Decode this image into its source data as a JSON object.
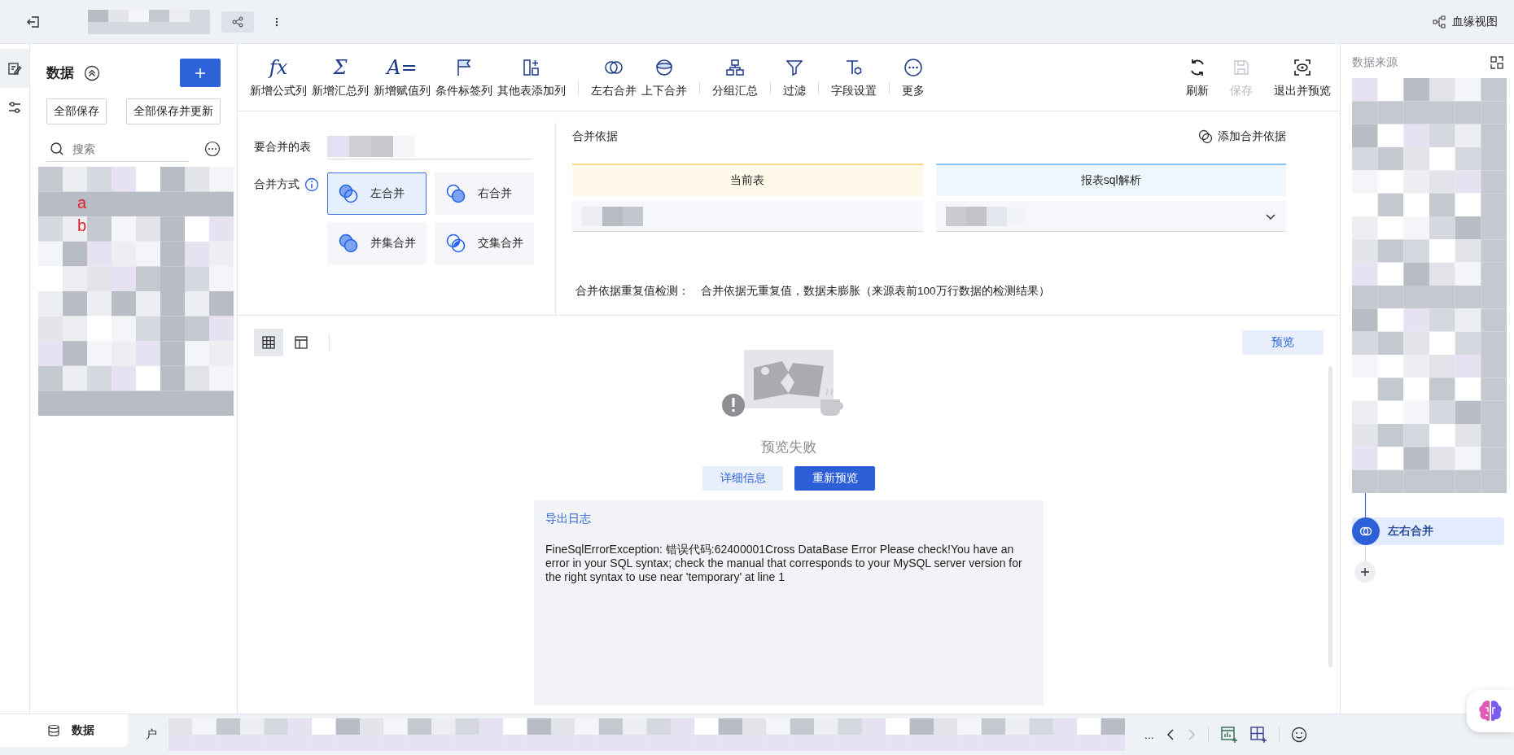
{
  "topbar": {
    "lineage_label": "血缘视图"
  },
  "sidebar": {
    "title": "数据",
    "buttons": [
      "全部保存",
      "全部保存并更新"
    ],
    "search": {
      "placeholder": "搜索"
    },
    "annotations": [
      "a",
      "b"
    ]
  },
  "toolbar": {
    "groups": [
      [
        {
          "label": "新增公式列",
          "kind": "glyph",
          "glyph": "fx"
        },
        {
          "label": "新增汇总列",
          "kind": "glyph",
          "glyph": "Σ"
        },
        {
          "label": "新增赋值列",
          "kind": "glyph",
          "glyph": "A="
        },
        {
          "label": "条件标签列",
          "kind": "flag"
        },
        {
          "label": "其他表添加列",
          "kind": "addcol"
        }
      ],
      [
        {
          "label": "左右合并",
          "kind": "lr"
        },
        {
          "label": "上下合并",
          "kind": "ud"
        }
      ],
      [
        {
          "label": "分组汇总",
          "kind": "group"
        }
      ],
      [
        {
          "label": "过滤",
          "kind": "filter"
        }
      ],
      [
        {
          "label": "字段设置",
          "kind": "field"
        }
      ],
      [
        {
          "label": "更多",
          "kind": "more"
        }
      ]
    ],
    "right": [
      {
        "label": "刷新",
        "kind": "refresh",
        "disabled": false
      },
      {
        "label": "保存",
        "kind": "save",
        "disabled": true
      },
      {
        "label": "退出并预览",
        "kind": "exit",
        "disabled": false
      }
    ]
  },
  "merge": {
    "table_label": "要合并的表",
    "mode_label": "合并方式",
    "modes": [
      {
        "label": "左合并",
        "kind": "left",
        "selected": true
      },
      {
        "label": "右合并",
        "kind": "right",
        "selected": false
      },
      {
        "label": "并集合并",
        "kind": "union",
        "selected": false
      },
      {
        "label": "交集合并",
        "kind": "inter",
        "selected": false
      }
    ],
    "basis_label": "合并依据",
    "add_basis": "添加合并依据",
    "current_table": "当前表",
    "other_table": "报表sql解析",
    "check_label": "合并依据重复值检测：",
    "check_result": "合并依据无重复值，数据未膨胀（来源表前100万行数据的检测结果）"
  },
  "preview": {
    "view_tabs": [
      {
        "kind": "grid",
        "selected": true
      },
      {
        "kind": "layout",
        "selected": false
      }
    ],
    "preview_button": "预览",
    "status": "预览失败",
    "detail_button": "详细信息",
    "retry_button": "重新预览",
    "log": {
      "title": "导出日志",
      "message": "FineSqlErrorException: 错误代码:62400001Cross DataBase Error Please check!You have an error in your SQL syntax; check the manual that corresponds to your MySQL server version for the right syntax to use near 'temporary' at line 1"
    }
  },
  "datasource": {
    "title": "数据来源",
    "steps": [
      {
        "label": "左右合并",
        "selected": true
      }
    ]
  },
  "bottom": {
    "tab": "数据",
    "partial": "户",
    "overflow": "..."
  }
}
